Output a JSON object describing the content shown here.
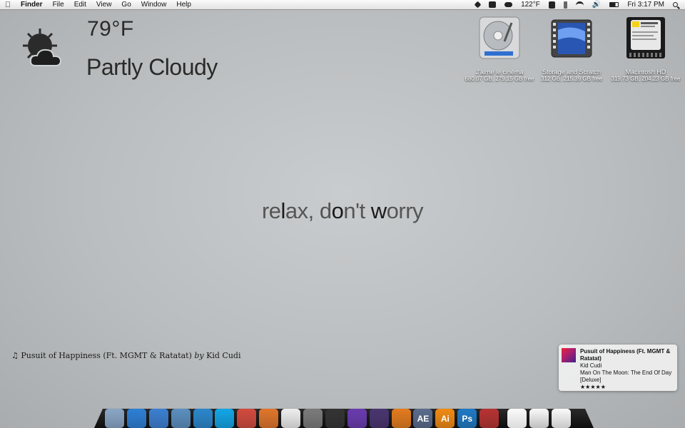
{
  "menubar": {
    "apple_icon": "apple-icon",
    "menus": [
      "Finder",
      "File",
      "Edit",
      "View",
      "Go",
      "Window",
      "Help"
    ],
    "status": {
      "temperature": "122°F",
      "clock": "Fri 3:17 PM",
      "icons": [
        "dropbox-icon",
        "cat-icon",
        "cloud-icon",
        "display-icon",
        "bluetooth-icon",
        "wifi-icon",
        "volume-icon",
        "battery-icon",
        "spotlight-icon"
      ]
    }
  },
  "weather": {
    "temperature": "79°F",
    "condition": "Partly Cloudy",
    "icon": "partly-cloudy-icon"
  },
  "drives": [
    {
      "name": "J'aime le cinéma",
      "info": "680.07 GB, 279.15 GB free",
      "icon": "hard-drive-icon"
    },
    {
      "name": "Storage and Scratch",
      "info": "312 GB, 215.39 GB free",
      "icon": "film-drive-icon"
    },
    {
      "name": "Macintosh HD",
      "info": "319.73 GB, 204.23 GB free",
      "icon": "internal-hd-icon"
    }
  ],
  "tagline": {
    "parts": [
      "re",
      "l",
      "ax, d",
      "o",
      "n't ",
      "w",
      "orry"
    ]
  },
  "now_playing": {
    "track": "Pusuit of Happiness (Ft. MGMT & Ratatat)",
    "by": "by",
    "artist": "Kid Cudi"
  },
  "notification": {
    "title": "Pusuit of Happiness (Ft. MGMT & Ratatat)",
    "artist": "Kid Cudi",
    "album": "Man On The Moon: The End Of Day [Deluxe]",
    "rating": 5,
    "rating_text": "★★★★★"
  },
  "dock": {
    "items": [
      {
        "name": "finder",
        "label": "",
        "color": "#8aa6c6",
        "dot": true
      },
      {
        "name": "app-store",
        "label": "",
        "color": "#2d7fd6",
        "dot": true
      },
      {
        "name": "itunes",
        "label": "",
        "color": "#3b7fd1",
        "dot": true
      },
      {
        "name": "mail-bird",
        "label": "",
        "color": "#5b8fbf",
        "dot": false
      },
      {
        "name": "twitter",
        "label": "",
        "color": "#2a87cc",
        "dot": false
      },
      {
        "name": "skype",
        "label": "",
        "color": "#12a5e6",
        "dot": false
      },
      {
        "name": "chrome",
        "label": "",
        "color": "#d24a3e",
        "dot": false
      },
      {
        "name": "firefox",
        "label": "",
        "color": "#e0752b",
        "dot": false
      },
      {
        "name": "textedit",
        "label": "",
        "color": "#eeeeee",
        "dot": false
      },
      {
        "name": "pen-tool",
        "label": "",
        "color": "#7b7b7b",
        "dot": false
      },
      {
        "name": "final-cut-clapper",
        "label": "",
        "color": "#333333",
        "dot": false
      },
      {
        "name": "video-app",
        "label": "",
        "color": "#6a3bb0",
        "dot": false
      },
      {
        "name": "motion-app",
        "label": "",
        "color": "#4a3570",
        "dot": false
      },
      {
        "name": "blender",
        "label": "",
        "color": "#e37b1e",
        "dot": false
      },
      {
        "name": "after-effects",
        "label": "AE",
        "color": "#5a6b8c",
        "dot": false
      },
      {
        "name": "illustrator",
        "label": "Ai",
        "color": "#f08a12",
        "dot": false
      },
      {
        "name": "photoshop",
        "label": "Ps",
        "color": "#1f79c4",
        "dot": false
      },
      {
        "name": "system-prefs",
        "label": "",
        "color": "#b63232",
        "dot": false
      }
    ],
    "trailing": [
      {
        "name": "ipod",
        "color": "#dcdcdc"
      },
      {
        "name": "mail-stack",
        "color": "#bfbfbf"
      },
      {
        "name": "trash",
        "color": "#c8c8c8"
      }
    ]
  }
}
